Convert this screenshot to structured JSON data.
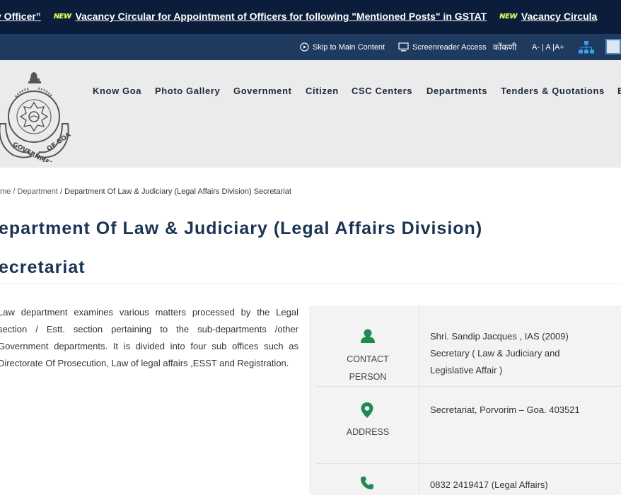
{
  "ticker": {
    "new_badge": "NEW",
    "items": [
      "y Officer”",
      "Vacancy Circular for Appointment of Officers for following \"Mentioned Posts\" in GSTAT",
      "Vacancy Circula"
    ]
  },
  "utility": {
    "skip": "Skip to Main Content",
    "screenreader": "Screenreader Access",
    "language": "कोंकणी",
    "font_size": "A- | A |A+"
  },
  "nav": [
    "Know Goa",
    "Photo Gallery",
    "Government",
    "Citizen",
    "CSC Centers",
    "Departments",
    "Tenders & Quotations",
    "E"
  ],
  "breadcrumb": {
    "home": "me /",
    "department": "Department /",
    "current": "Department Of Law & Judiciary (Legal Affairs Division) Secretariat"
  },
  "page": {
    "title_line1": "epartment Of Law & Judiciary (Legal Affairs Division)",
    "title_line2": "ecretariat",
    "description": "Law department examines various matters processed by the Legal section / Estt. section pertaining to the sub-departments /other Government departments. It is divided into four sub offices such as Directorate Of Prosecution, Law of legal affairs ,ESST and Registration."
  },
  "contact": {
    "person_label_1": "CONTACT",
    "person_label_2": "PERSON",
    "person_line1": "Shri. Sandip Jacques , IAS (2009)",
    "person_line2": "Secretary ( Law & Judiciary and",
    "person_line3": "Legislative Affair )",
    "address_label": "ADDRESS",
    "address": "Secretariat, Porvorim – Goa. 403521",
    "phone": "0832 2419417 (Legal Affairs)"
  },
  "colors": {
    "ticker_bg": "#0b1d3b",
    "utility_bg": "#1f3a5f",
    "header_bg": "#ebebeb",
    "accent_green": "#1e8a52",
    "title": "#1b3452"
  },
  "icons": {
    "skip": "play-circle-icon",
    "screenreader": "monitor-icon",
    "sitemap": "sitemap-icon",
    "person": "user-icon",
    "address": "map-marker-icon",
    "phone": "phone-icon"
  }
}
